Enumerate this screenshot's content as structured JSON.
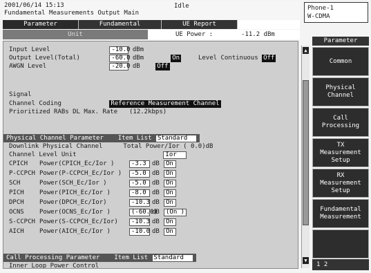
{
  "titlebar": {
    "datetime": "2001/06/14 15:13",
    "subtitle": "Fundamental Measurements Output Main",
    "status": "Idle"
  },
  "phone_box": {
    "line1": "Phone-1",
    "line2": "W-CDMA"
  },
  "tabs": [
    {
      "label": "Parameter"
    },
    {
      "label": "Fundamental"
    },
    {
      "label": "UE Report"
    }
  ],
  "header": {
    "unit": "Unit",
    "power_label": "UE Power :",
    "power_value": "-11.2 dBm"
  },
  "levels": {
    "input_label": "Input Level",
    "input_value": "-10.0",
    "input_unit": "dBm",
    "output_label": "Output Level(Total)",
    "output_value": "-60.0",
    "output_unit": "dBm",
    "output_state": "On",
    "continuous_label": "Level Continuous",
    "continuous_state": "Off",
    "awgn_label": "AWGN Level",
    "awgn_value": "-20.0",
    "awgn_unit": "dB",
    "awgn_state": "Off"
  },
  "signal": {
    "section": "Signal",
    "coding_label": "Channel Coding",
    "coding_value": "Reference Measurement Channel",
    "rab_label": "Prioritized RABs DL Max. Rate",
    "rab_value": "(12.2kbps)"
  },
  "phys": {
    "section": "Physical Channel Parameter",
    "item_list_label": "Item List",
    "item_list_value": "Standard",
    "dl_label": "Downlink Physical Channel",
    "total_label": "Total Power/Ior (  0.0)dB",
    "unit_label": "Channel Level Unit",
    "unit_value": "Ior",
    "rows": [
      {
        "name": "CPICH",
        "power": "Power(CPICH_Ec/Ior    )",
        "value": "-3.3",
        "unit": "dB",
        "state": "On"
      },
      {
        "name": "P-CCPCH",
        "power": "Power(P-CCPCH_Ec/Ior   )",
        "value": "-5.0",
        "unit": "dB",
        "state": "On"
      },
      {
        "name": "SCH",
        "power": "Power(SCH_Ec/Ior      )",
        "value": "-5.0",
        "unit": "dB",
        "state": "On"
      },
      {
        "name": "PICH",
        "power": "Power(PICH_Ec/Ior    )",
        "value": "-8.0",
        "unit": "dB",
        "state": "On"
      },
      {
        "name": "DPCH",
        "power": "Power(DPCH_Ec/Ior)",
        "value": "-10.3",
        "unit": "dB",
        "state": "On"
      },
      {
        "name": "OCNS",
        "power": "Power(OCNS_Ec/Ior    )",
        "value": "(-60.0)",
        "unit": "dB",
        "state": "(On )"
      },
      {
        "name": "S-CCPCH",
        "power": "Power(S-CCPCH_Ec/Ior)",
        "value": "-10.3",
        "unit": "dB",
        "state": "On"
      },
      {
        "name": "AICH",
        "power": "Power(AICH_Ec/Ior    )",
        "value": "-10.0",
        "unit": "dB",
        "state": "On"
      }
    ]
  },
  "callproc": {
    "section": "Call Processing Parameter",
    "item_list_label": "Item List",
    "item_list_value": "Standard",
    "next_row": "Inner Loop Power Control"
  },
  "softkeys": {
    "title": "Parameter",
    "keys": [
      {
        "label": "Common"
      },
      {
        "label": "Physical\nChannel"
      },
      {
        "label": "Call\nProcessing"
      },
      {
        "label": "TX\nMeasurement\nSetup"
      },
      {
        "label": "RX\nMeasurement\nSetup"
      },
      {
        "label": "Fundamental\nMeasurement"
      },
      {
        "label": ""
      }
    ],
    "pager": "1 2"
  }
}
